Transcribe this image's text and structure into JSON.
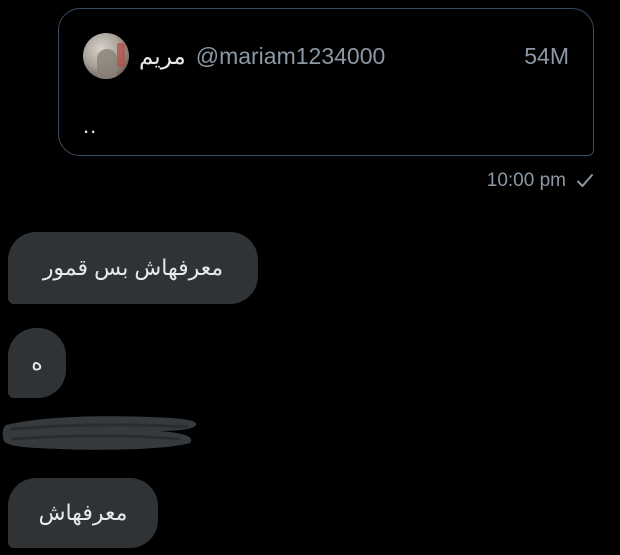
{
  "quote": {
    "display_name": "مريم",
    "handle": "@mariam1234000",
    "views": "54M",
    "text": ".."
  },
  "sent_meta": {
    "time": "10:00 pm",
    "status_icon": "check-icon"
  },
  "messages": [
    {
      "text": "معرفهاش بس قمور"
    },
    {
      "text": "ه"
    },
    {
      "text": "معرفهاش"
    }
  ],
  "colors": {
    "background": "#000000",
    "card_border": "#3b4b63",
    "bubble": "#2f3336",
    "muted_text": "#8b98a5",
    "primary_text": "#e7e9ea"
  }
}
